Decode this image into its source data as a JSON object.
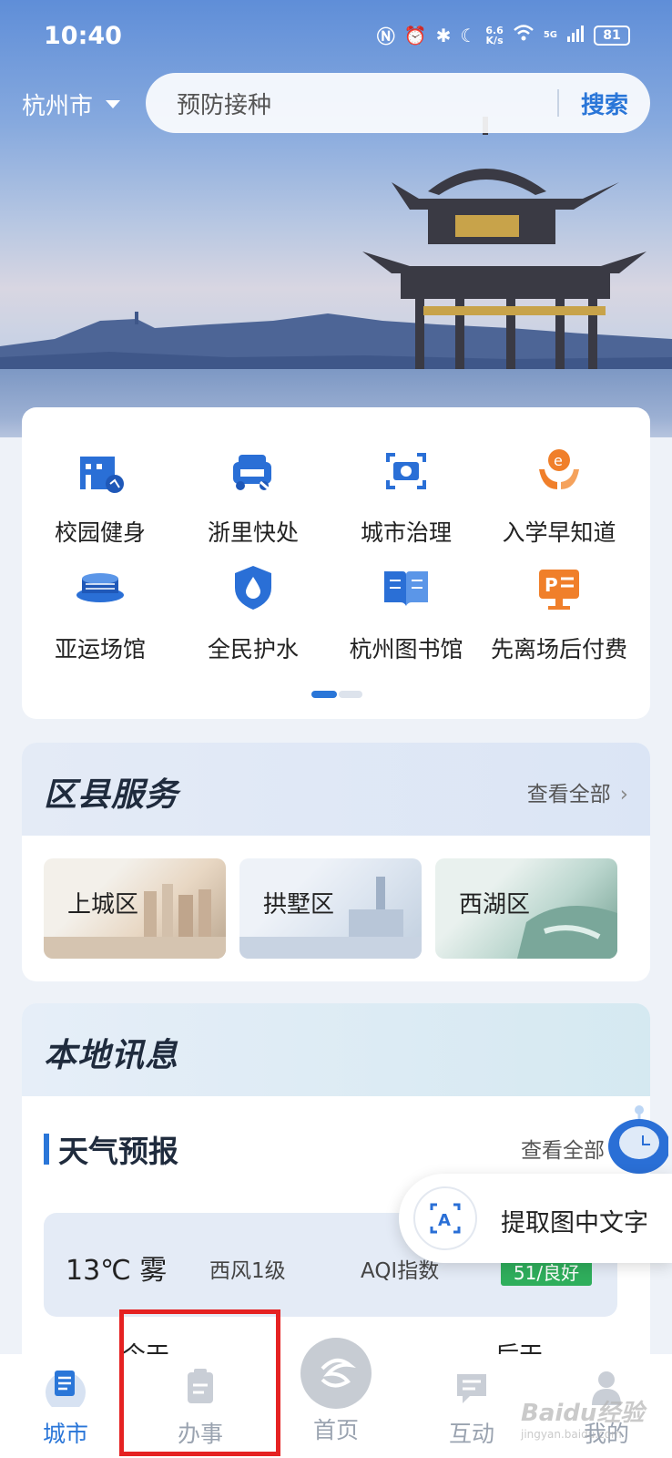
{
  "status_bar": {
    "time": "10:40",
    "net_speed_top": "6.6",
    "net_speed_unit": "K/s",
    "signal_label": "5G",
    "battery": "81"
  },
  "header": {
    "city": "杭州市",
    "search_placeholder": "预防接种",
    "search_button": "搜索"
  },
  "apps": [
    {
      "label": "校园健身",
      "icon": "campus-fitness-icon",
      "color": "#2a6fd6"
    },
    {
      "label": "浙里快处",
      "icon": "car-accident-icon",
      "color": "#2a6fd6"
    },
    {
      "label": "城市治理",
      "icon": "city-camera-icon",
      "color": "#2a6fd6"
    },
    {
      "label": "入学早知道",
      "icon": "enrollment-icon",
      "color": "#f07f2a"
    },
    {
      "label": "亚运场馆",
      "icon": "stadium-icon",
      "color": "#2a6fd6"
    },
    {
      "label": "全民护水",
      "icon": "water-shield-icon",
      "color": "#2a6fd6"
    },
    {
      "label": "杭州图书馆",
      "icon": "library-book-icon",
      "color": "#2a6fd6"
    },
    {
      "label": "先离场后付费",
      "icon": "parking-pay-icon",
      "color": "#f07f2a"
    }
  ],
  "district": {
    "title": "区县服务",
    "view_all": "查看全部",
    "tiles": [
      "上城区",
      "拱墅区",
      "西湖区"
    ]
  },
  "news": {
    "title": "本地讯息",
    "weather_title": "天气预报",
    "view_all": "查看全部",
    "weather": {
      "temp": "13℃ 雾",
      "wind": "西风1级",
      "aqi": "AQI指数",
      "aqi_badge": "51/良好"
    },
    "row_left": "今天",
    "row_right": "后天"
  },
  "overlay": {
    "extract_text": "提取图中文字"
  },
  "nav": {
    "items": [
      "城市",
      "办事",
      "首页",
      "互动",
      "我的"
    ],
    "active_index": 0,
    "accent": "#2a76d8",
    "highlight_color": "#e52222"
  },
  "watermark": {
    "text": "Baidu经验",
    "sub": "jingyan.baidu.com"
  }
}
